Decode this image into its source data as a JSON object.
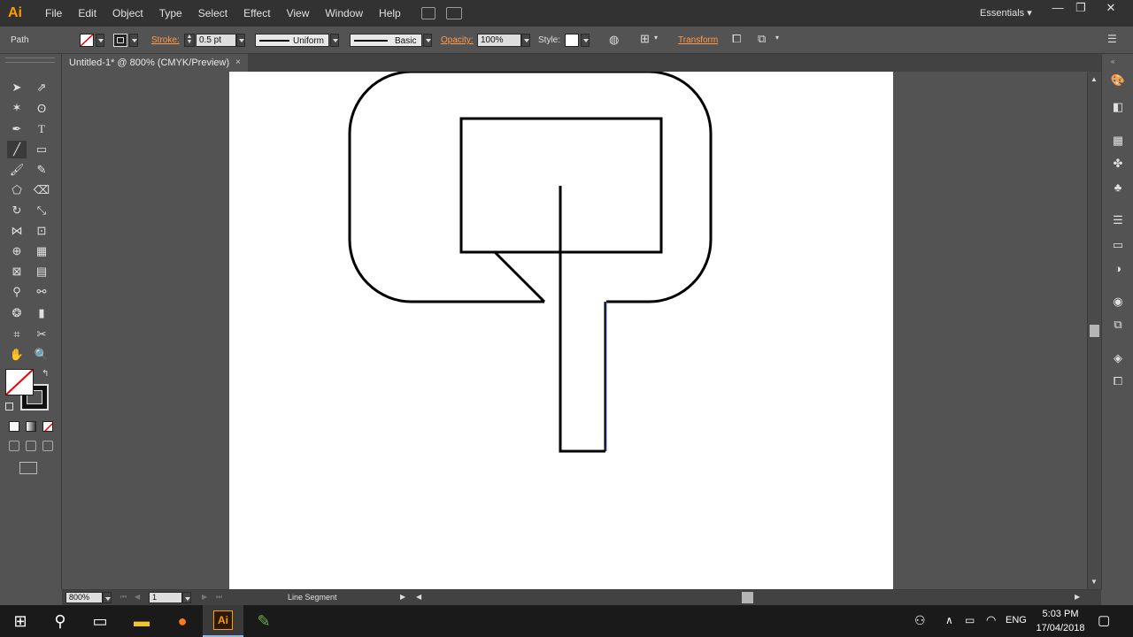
{
  "app": {
    "logo": "Ai"
  },
  "menu": [
    "File",
    "Edit",
    "Object",
    "Type",
    "Select",
    "Effect",
    "View",
    "Window",
    "Help"
  ],
  "workspace": "Essentials",
  "window_buttons": [
    "—",
    "❐",
    "✕"
  ],
  "control": {
    "selection_type": "Path",
    "stroke_label": "Stroke:",
    "stroke_weight": "0.5 pt",
    "profile": "Uniform",
    "brush": "Basic",
    "opacity_label": "Opacity:",
    "opacity": "100%",
    "style_label": "Style:",
    "transform_label": "Transform"
  },
  "document_tab": {
    "title": "Untitled-1* @ 800% (CMYK/Preview)",
    "close": "×"
  },
  "status": {
    "zoom": "800%",
    "artboard": "1",
    "current_tool": "Line Segment"
  },
  "taskbar": {
    "language": "ENG",
    "time": "5:03 PM",
    "date": "17/04/2018"
  },
  "icons": {
    "start": "windows-start-icon",
    "search": "search-icon",
    "task_view": "task-view-icon",
    "explorer": "file-explorer-icon",
    "firefox": "firefox-icon",
    "illustrator": "illustrator-icon",
    "paint": "paint-icon"
  },
  "colors": {
    "accent": "#ff9a00",
    "link": "#ff9a4a",
    "artboard": "#ffffff",
    "pasteboard": "#535353"
  }
}
